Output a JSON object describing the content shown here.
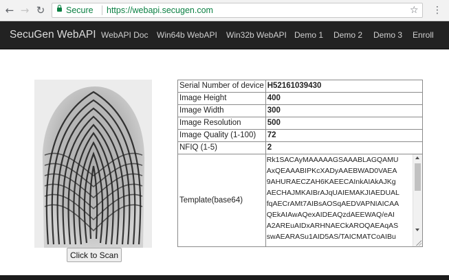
{
  "browser": {
    "secure_label": "Secure",
    "url": "https://webapi.secugen.com"
  },
  "navbar": {
    "brand": "SecuGen WebAPI",
    "links": [
      "WebAPI Doc",
      "Win64b WebAPI",
      "Win32b WebAPI",
      "Demo 1",
      "Demo 2",
      "Demo 3",
      "Enroll"
    ]
  },
  "scan_button": "Click to Scan",
  "device_info": [
    {
      "label": "Serial Number of device",
      "value": "H52161039430"
    },
    {
      "label": "Image Height",
      "value": "400"
    },
    {
      "label": "Image Width",
      "value": "300"
    },
    {
      "label": "Image Resolution",
      "value": "500"
    },
    {
      "label": "Image Quality (1-100)",
      "value": "72"
    },
    {
      "label": "NFIQ (1-5)",
      "value": "2"
    }
  ],
  "template": {
    "label": "Template(base64)",
    "lines": [
      "Rk1SACAyMAAAAAGSAAABLAGQAMU",
      "AxQEAAABIPKcXADyAAEBWAD0VAEA",
      "9AHURAECZAH6KAEECAInkAIAkAJKg",
      "AECHAJMKAIBrAJqUAIEMAKJIAEDUAL",
      "fqAECrAMt7AIBsAOSqAEDVAPNIAICAA",
      "QEkAIAwAQexAIDEAQzdAEEWAQ/eAI",
      "A2AREuAIDxARHNAECkAROQAEAqAS",
      "swAEARASu1AID5AS/TAICMATCoAIBu"
    ]
  }
}
